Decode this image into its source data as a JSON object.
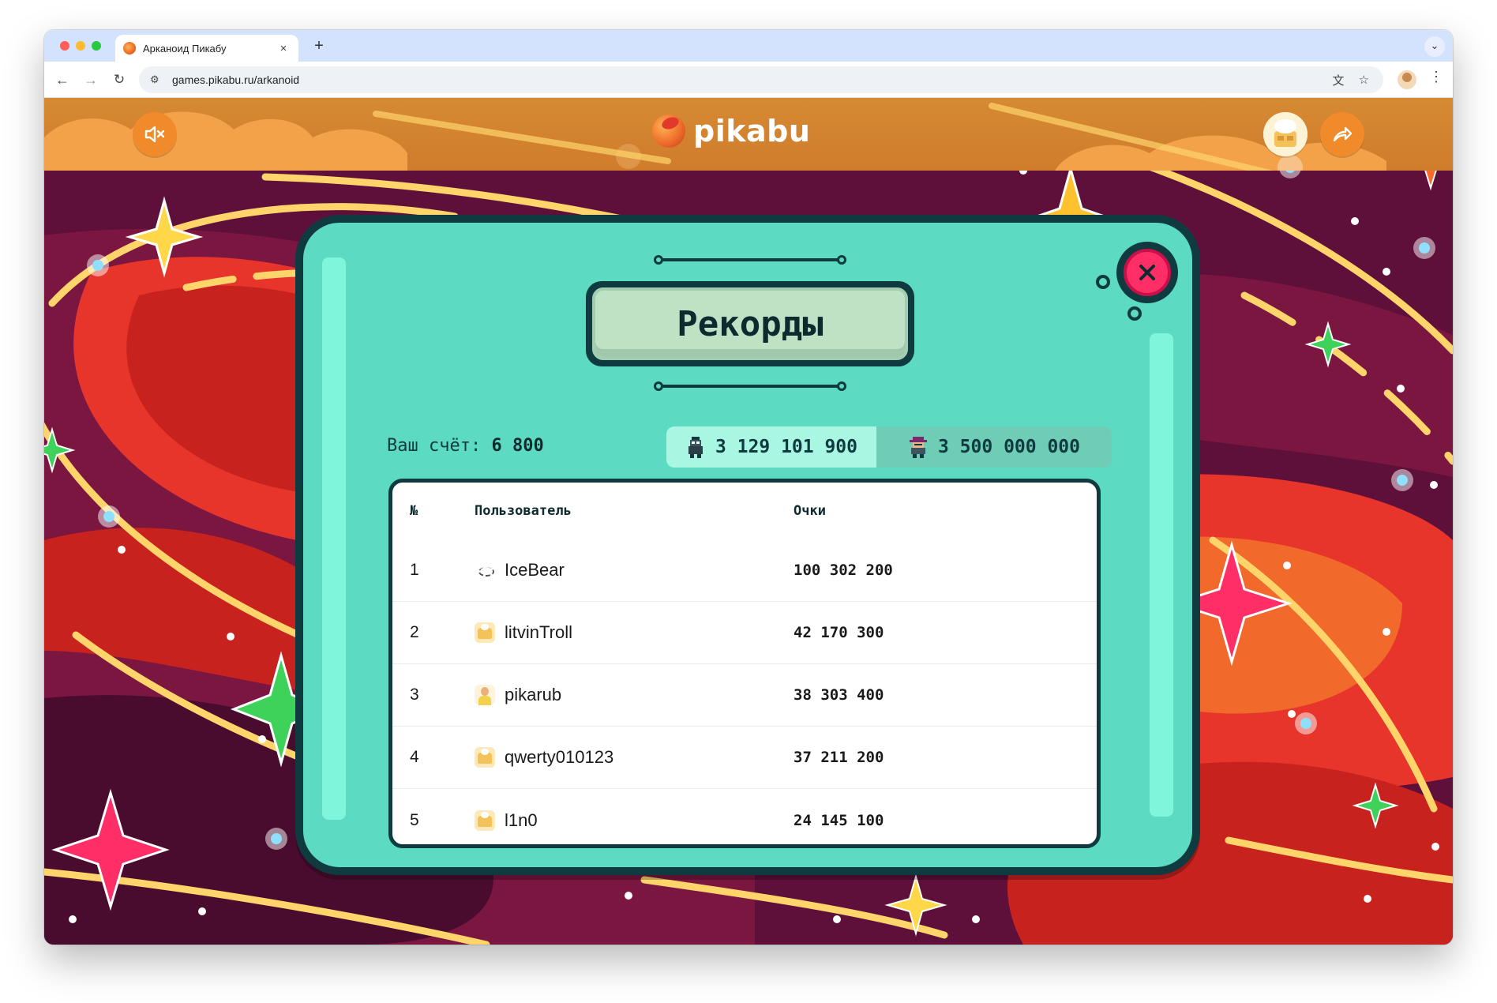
{
  "browser": {
    "tab_title": "Арканоид Пикабу",
    "tab_close": "×",
    "new_tab": "+",
    "tab_menu": "⌄",
    "url": "games.pikabu.ru/arkanoid"
  },
  "header": {
    "logo_text": "pikabu",
    "sound_state": "muted"
  },
  "records": {
    "title": "Рекорды",
    "score_label": "Ваш счёт:",
    "score_value": "6 800",
    "tabs": [
      {
        "label": "3 129 101 900",
        "icon": "pixel-character-icon",
        "active": true
      },
      {
        "label": "3 500 000 000",
        "icon": "pixel-character-hat-icon",
        "active": false
      }
    ],
    "columns": {
      "num": "№",
      "user": "Пользователь",
      "score": "Очки"
    },
    "rows": [
      {
        "rank": "1",
        "user": "IceBear",
        "avatar": "bear-icon",
        "score": "100 302 200"
      },
      {
        "rank": "2",
        "user": "litvinTroll",
        "avatar": "pikabu-default-avatar",
        "score": "42 170 300"
      },
      {
        "rank": "3",
        "user": "pikarub",
        "avatar": "person-avatar",
        "score": "38 303 400"
      },
      {
        "rank": "4",
        "user": "qwerty010123",
        "avatar": "pikabu-default-avatar",
        "score": "37 211 200"
      },
      {
        "rank": "5",
        "user": "l1n0",
        "avatar": "pikabu-default-avatar",
        "score": "24 145 100"
      }
    ]
  },
  "colors": {
    "modal_bg": "#5cdbc2",
    "modal_border": "#0f3a40",
    "close_button": "#ff2e66",
    "header_bg": "#d68a33",
    "background": "#5e0f3a"
  }
}
